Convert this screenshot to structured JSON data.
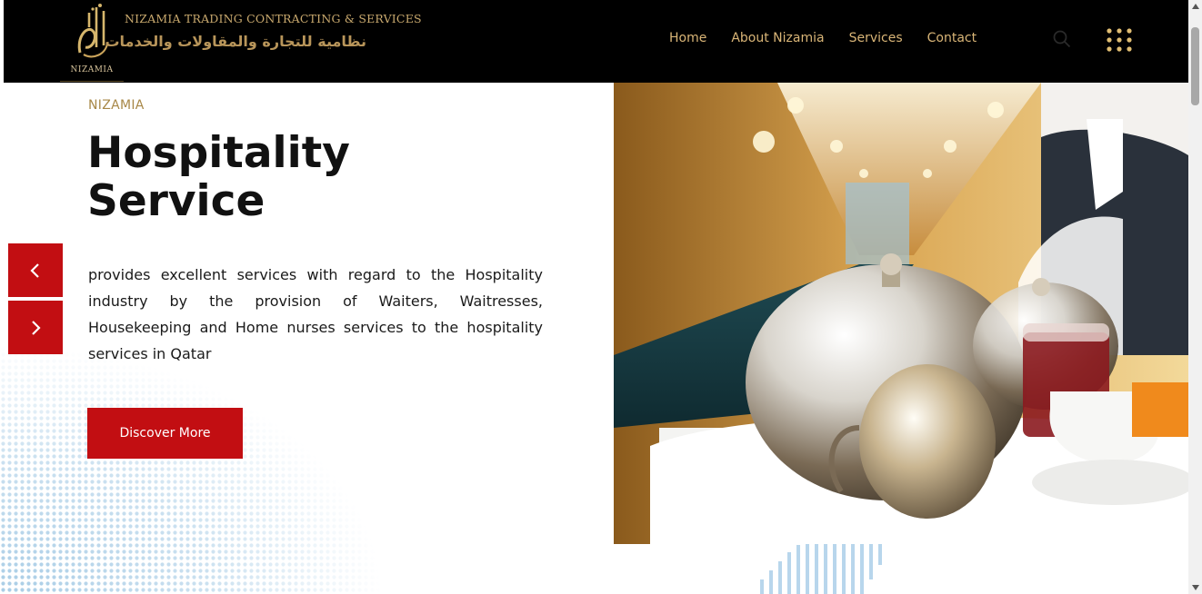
{
  "header": {
    "logo_caption": "NIZAMIA",
    "brand_en": "NIZAMIA TRADING  CONTRACTING & SERVICES",
    "brand_ar": "نظامية للتجارة والمقاولات والخدمات",
    "nav": [
      {
        "label": "Home"
      },
      {
        "label": "About Nizamia"
      },
      {
        "label": "Services"
      },
      {
        "label": "Contact"
      }
    ],
    "search_icon": "search-icon",
    "menu_icon": "grid-menu-icon"
  },
  "hero": {
    "eyebrow": "NIZAMIA",
    "title_line1": "Hospitality",
    "title_line2": "Service",
    "description": "provides excellent services with regard to the Hospitality industry by the provision of Waiters, Waitresses, Housekeeping and Home nurses services to the hospitality services in Qatar",
    "cta_label": "Discover More",
    "prev_icon": "chevron-left-icon",
    "next_icon": "chevron-right-icon"
  },
  "colors": {
    "accent_red": "#c20e12",
    "gold": "#d9b577",
    "header_bg": "#000000"
  }
}
